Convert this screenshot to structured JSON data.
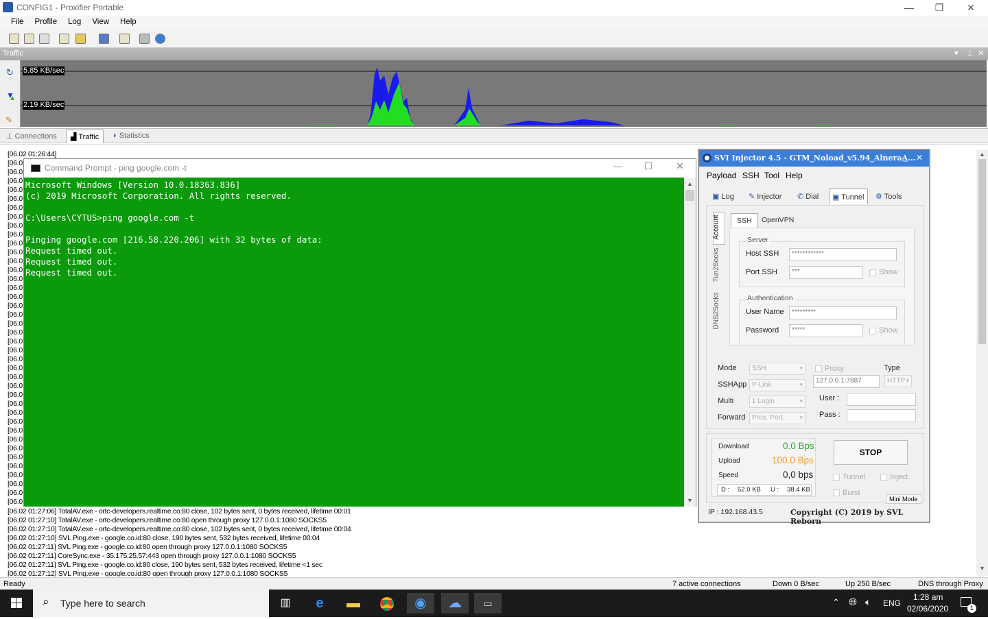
{
  "window": {
    "title": "CONFIG1 - Proxifier Portable"
  },
  "menu": [
    "File",
    "Profile",
    "Log",
    "View",
    "Help"
  ],
  "traffic_panel": {
    "title": "Traffic",
    "rate_high": "5.85 KB/sec",
    "rate_low": "2.19 KB/sec"
  },
  "tabs": [
    "Connections",
    "Traffic",
    "Statistics"
  ],
  "log_prefix": "[06.02 01:26:44]",
  "log_short": "[06.0",
  "log_tail": [
    "[06.02 01:27:06] TotalAV.exe - ortc-developers.realtime.co:80 close, 102 bytes sent, 0 bytes received, lifetime 00:01",
    "[06.02 01:27:10] TotalAV.exe - ortc-developers.realtime.co:80 open through proxy 127.0.0.1:1080 SOCKS5",
    "[06.02 01:27:10] TotalAV.exe - ortc-developers.realtime.co:80 close, 102 bytes sent, 0 bytes received, lifetime 00:04",
    "[06.02 01:27:10] SVL Ping.exe - google.co.id:80 close, 190 bytes sent, 532 bytes received, lifetime 00:04",
    "[06.02 01:27:11] SVL Ping.exe - google.co.id:80 open through proxy 127.0.0.1:1080 SOCKS5",
    "[06.02 01:27:11] CoreSync.exe - 35.175.25.57:443 open through proxy 127.0.0.1:1080 SOCKS5",
    "[06.02 01:27:11] SVL Ping.exe - google.co.id:80 close, 190 bytes sent, 532 bytes received, lifetime <1 sec",
    "[06.02 01:27:12] SVL Ping.exe - google.co.id:80 open through proxy 127.0.0.1:1080 SOCKS5"
  ],
  "status": {
    "ready": "Ready",
    "connections": "7 active connections",
    "down": "Down 0 B/sec",
    "up": "Up 250 B/sec",
    "dns": "DNS through Proxy"
  },
  "cmd": {
    "title": "Command Prompt - ping  google.com -t",
    "output": "Microsoft Windows [Version 10.0.18363.836]\n(c) 2019 Microsoft Corporation. All rights reserved.\n\nC:\\Users\\CYTUS>ping google.com -t\n\nPinging google.com [216.58.220.206] with 32 bytes of data:\nRequest timed out.\nRequest timed out.\nRequest timed out."
  },
  "svi": {
    "title": "SVI Injector 4.5 - GTM_Noload_v5.94_AlneraA...",
    "menu": [
      "Payload",
      "SSH",
      "Tool",
      "Help"
    ],
    "tabs": [
      "Log",
      "Injector",
      "Dial",
      "Tunnel",
      "Tools"
    ],
    "side_tabs": [
      "Account",
      "Tun2Socks",
      "DNS2Socks"
    ],
    "subtabs": [
      "SSH",
      "OpenVPN"
    ],
    "server_label": "Server",
    "host_label": "Host SSH",
    "host_value": "************",
    "port_label": "Port SSH",
    "port_value": "***",
    "show": "Show",
    "auth_label": "Authentication",
    "user_label": "User Name",
    "user_value": "*********",
    "pass_label": "Password",
    "pass_value": "*****",
    "mode_label": "Mode",
    "mode_value": "SSH",
    "sshapp_label": "SSHApp",
    "sshapp_value": "P-Link",
    "multi_label": "Multi",
    "multi_value": "1 Login",
    "forward_label": "Forward",
    "forward_value": "Prox. Port.",
    "proxy_label": "Proxy",
    "proxy_value": "127.0.0.1:7887",
    "type_label": "Type",
    "type_value": "HTTP",
    "puser_label": "User  :",
    "ppass_label": "Pass  :",
    "download_label": "Download",
    "download_value": "0.0 Bps",
    "upload_label": "Upload",
    "upload_value": "100.0 Bps",
    "speed_label": "Speed",
    "speed_value": "0,0 bps",
    "d_label": "D :",
    "d_value": "52.0 KB",
    "u_label": "U :",
    "u_value": "38.4 KB",
    "stop": "STOP",
    "tunnel_chk": "Tunnel",
    "inject_chk": "Inject",
    "burst_chk": "Burst",
    "mini_mode": "Mini Mode",
    "ip": "IP : 192.168.43.5",
    "copyright": "Copyright (C) 2019 by SVL Reborn",
    "colors": {
      "download": "#2fa82f",
      "upload": "#f0a020"
    }
  },
  "taskbar": {
    "search_placeholder": "Type here to search",
    "lang": "ENG",
    "time": "1:28 am",
    "date": "02/06/2020",
    "notif_count": "1"
  }
}
